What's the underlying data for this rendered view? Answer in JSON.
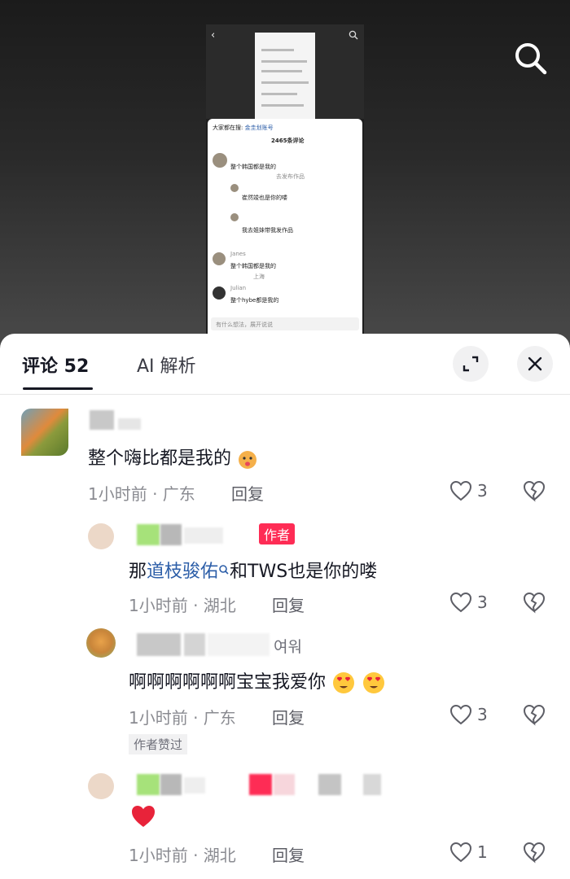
{
  "video_overlay": {
    "inner_screenshot": {
      "hot_search_prefix": "大家都在搜:",
      "hot_search_term": "金圭划账号",
      "comment_count": "2465条评论",
      "comments": [
        {
          "text": "整个韩国都是我的",
          "action": "去发布作品"
        },
        {
          "text": "崔然竣也是你的喽"
        },
        {
          "text": "我去姐妹带我发作品"
        },
        {
          "user": "Janes",
          "text": "整个韩国都是我的",
          "location": "上海"
        },
        {
          "user": "Julian",
          "text": "整个hybe都是我的"
        }
      ],
      "input_placeholder": "有什么想法，展开说说"
    }
  },
  "sheet": {
    "tabs": [
      {
        "label": "评论 52",
        "active": true
      },
      {
        "label": "AI 解析",
        "active": false
      }
    ],
    "icons": {
      "expand": "expand-icon",
      "close": "close-icon"
    }
  },
  "comments": [
    {
      "text": "整个嗨比都是我的",
      "time": "1小时前 · 广东",
      "reply": "回复",
      "likes": "3"
    },
    {
      "author_tag": "作者",
      "text_prefix": "那",
      "text_link": "道枝骏佑",
      "text_suffix": "和TWS也是你的喽",
      "time": "1小时前 · 湖北",
      "reply": "回复",
      "likes": "3"
    },
    {
      "user_fragment": "여워",
      "text": "啊啊啊啊啊啊宝宝我爱你",
      "time": "1小时前 · 广东",
      "reply": "回复",
      "likes": "3",
      "author_liked": "作者赞过"
    },
    {
      "time": "1小时前 · 湖北",
      "reply": "回复",
      "likes": "1"
    }
  ],
  "colors": {
    "accent": "#fe2c55",
    "link": "#2c5ea8",
    "text": "#161823",
    "meta": "#8a8b91"
  }
}
